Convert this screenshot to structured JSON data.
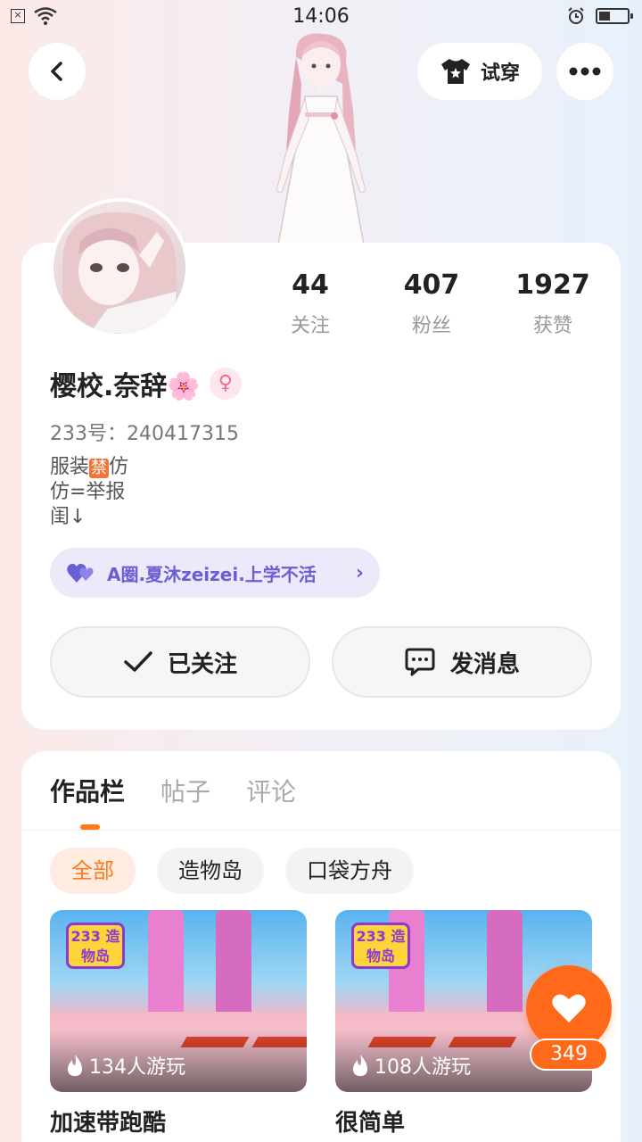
{
  "status_bar": {
    "time": "14:06"
  },
  "header": {
    "tryon_label": "试穿"
  },
  "profile": {
    "name": "樱校.奈辞🌸",
    "gender_symbol": "♀",
    "uid_text": "233号：240417315",
    "bio_lines": [
      "服装",
      "仿",
      "仿=举报",
      "闺↓"
    ],
    "bio_badge": "禁",
    "stats": [
      {
        "num": "44",
        "label": "关注"
      },
      {
        "num": "407",
        "label": "粉丝"
      },
      {
        "num": "1927",
        "label": "获赞"
      }
    ],
    "circle_chip": "A圈.夏沐zeizei.上学不活",
    "follow_label": "已关注",
    "message_label": "发消息"
  },
  "works": {
    "tabs": [
      "作品栏",
      "帖子",
      "评论"
    ],
    "filters": [
      "全部",
      "造物岛",
      "口袋方舟"
    ],
    "games": [
      {
        "title": "加速带跑酷",
        "plays": "134人游玩",
        "logo": "233 造物岛"
      },
      {
        "title": "很简单",
        "plays": "108人游玩",
        "logo": "233 造物岛"
      }
    ],
    "like_count": "349"
  },
  "colors": {
    "accent": "#ff7a1a",
    "chip": "#6a5ed4",
    "gender": "#f06a92"
  }
}
